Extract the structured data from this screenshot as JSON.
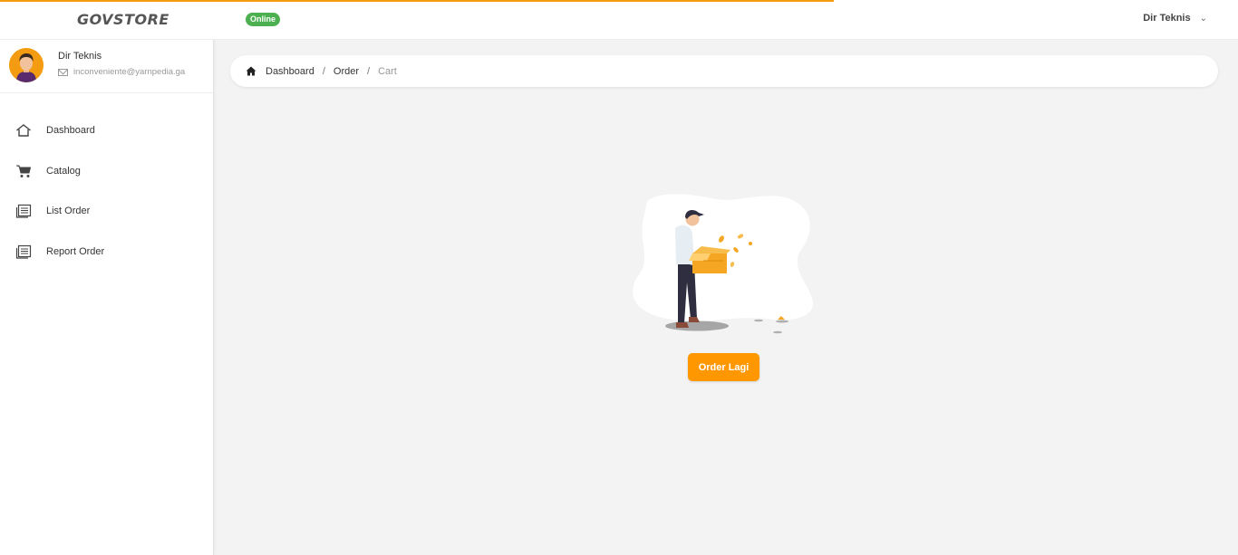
{
  "header": {
    "brand": "GOVSTORE",
    "status": "Online",
    "user_name": "Dir Teknis"
  },
  "sidebar": {
    "profile": {
      "name": "Dir Teknis",
      "email": "inconveniente@yarnpedia.ga"
    },
    "items": [
      {
        "label": "Dashboard",
        "icon": "home-icon"
      },
      {
        "label": "Catalog",
        "icon": "cart-icon"
      },
      {
        "label": "List Order",
        "icon": "list-icon"
      },
      {
        "label": "Report Order",
        "icon": "report-icon"
      }
    ]
  },
  "breadcrumb": {
    "items": [
      "Dashboard",
      "Order",
      "Cart"
    ],
    "separator": "/"
  },
  "main": {
    "button_label": "Order Lagi"
  },
  "colors": {
    "accent": "#ff9800",
    "online": "#4caf50"
  }
}
